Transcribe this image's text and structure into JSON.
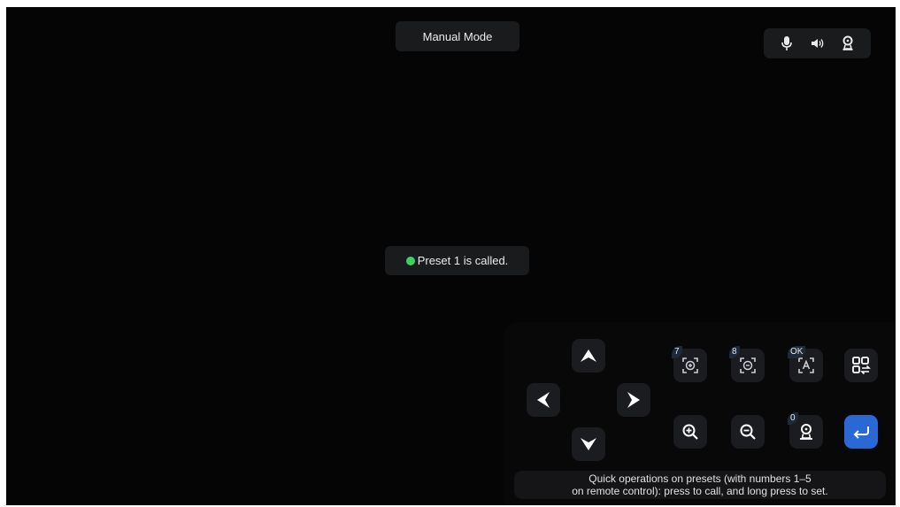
{
  "header": {
    "mode_label": "Manual Mode"
  },
  "status_icons": [
    "microphone-icon",
    "speaker-icon",
    "camera-icon"
  ],
  "toast": {
    "text": "Preset 1 is called.",
    "dot_color": "#3dd05f"
  },
  "controls": {
    "preset_buttons": [
      {
        "key": "7",
        "icon": "zoom-in-frame-icon"
      },
      {
        "key": "8",
        "icon": "zoom-out-frame-icon"
      },
      {
        "key": "OK",
        "icon": "auto-frame-icon"
      },
      {
        "key": "0",
        "icon": "camera-reset-icon"
      }
    ],
    "accent": "#2a68d6"
  },
  "hint": {
    "line1": "Quick operations on presets (with numbers 1–5",
    "line2": "on remote control): press to call, and long press to set."
  }
}
